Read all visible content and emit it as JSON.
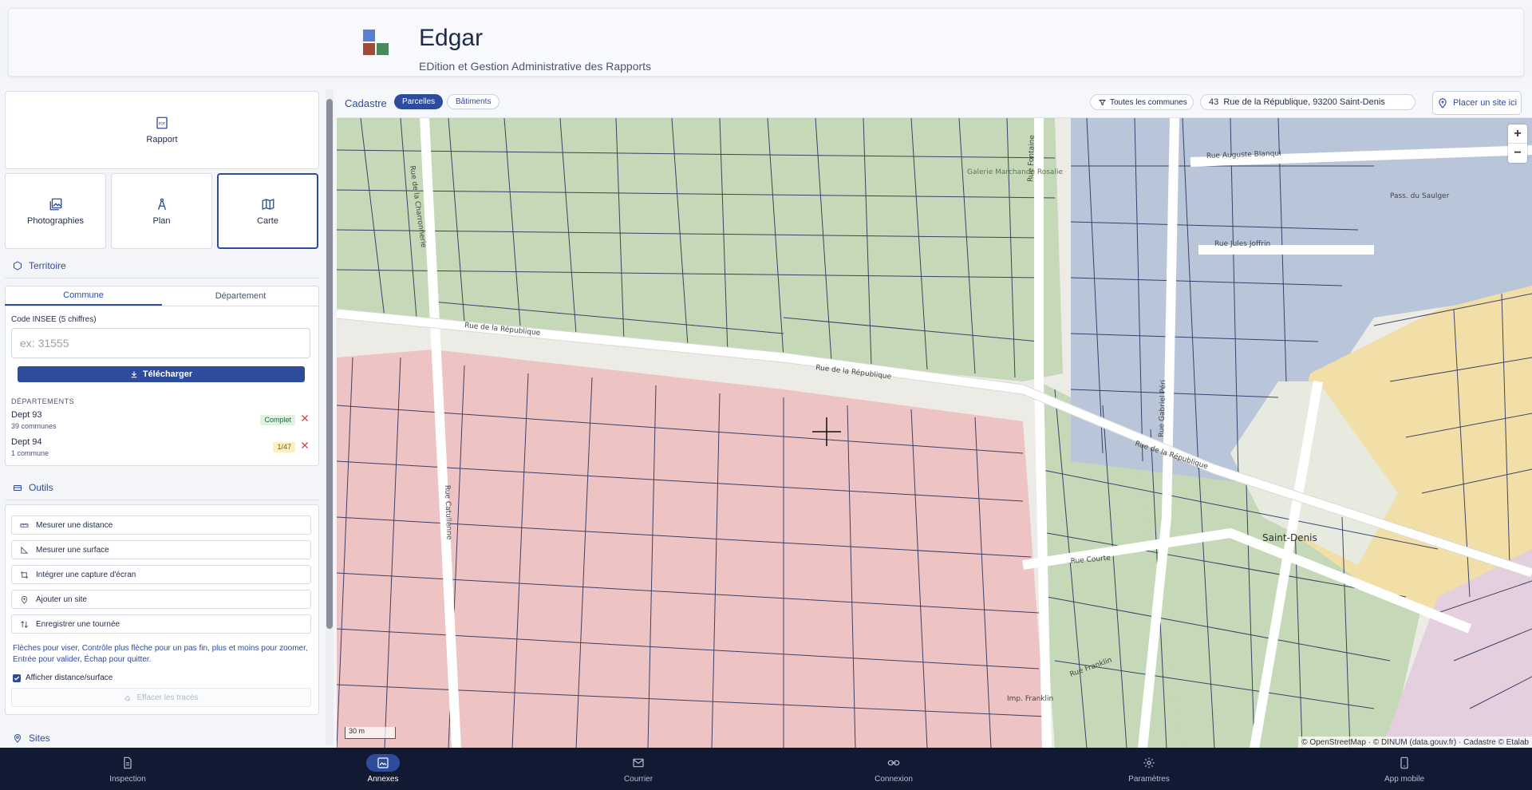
{
  "header": {
    "title": "Edgar",
    "subtitle": "EDition et Gestion Administrative des Rapports",
    "logo_colors": [
      "#5b7fd6",
      "#a04a3a",
      "#4a8a5a",
      "#ffffff"
    ]
  },
  "sidebar": {
    "tiles": [
      {
        "label": "Rapport",
        "icon": "pdf-icon"
      },
      {
        "label": "Photographies",
        "icon": "gallery-icon"
      },
      {
        "label": "Plan",
        "icon": "compass-icon"
      },
      {
        "label": "Carte",
        "icon": "map-icon"
      }
    ],
    "territoire": {
      "heading": "Territoire",
      "tabs": [
        "Commune",
        "Département"
      ],
      "field_label": "Code INSEE (5 chiffres)",
      "placeholder": "ex: 31555",
      "download_label": "Télécharger",
      "departements_heading": "Départements",
      "departements": [
        {
          "name": "Dept 93",
          "count": "39 communes",
          "badge": "Complet"
        },
        {
          "name": "Dept 94",
          "count": "1 commune",
          "badge": "1/47"
        }
      ]
    },
    "outils": {
      "heading": "Outils",
      "tools": [
        {
          "label": "Mesurer une distance",
          "icon": "ruler-icon"
        },
        {
          "label": "Mesurer une surface",
          "icon": "area-icon"
        },
        {
          "label": "Intégrer une capture d'écran",
          "icon": "crop-icon"
        },
        {
          "label": "Ajouter un site",
          "icon": "add-location-icon"
        },
        {
          "label": "Enregistrer une tournée",
          "icon": "route-icon"
        }
      ],
      "hint": "Flèches pour viser, Contrôle plus flèche pour un pas fin, plus et moins pour zoomer, Entrée pour valider, Échap pour quitter.",
      "checkbox_label": "Afficher distance/surface",
      "clear_label": "Effacer les tracés"
    },
    "sites": {
      "heading": "Sites"
    }
  },
  "map": {
    "cadastre_label": "Cadastre",
    "pills": [
      "Parcelles",
      "Bâtiments"
    ],
    "filter_label": "Toutes les communes",
    "address": "43  Rue de la République, 93200 Saint-Denis",
    "place_label": "Placer un site ici",
    "zoom_in": "+",
    "zoom_out": "−",
    "scale": "30 m",
    "attribution": "© OpenStreetMap · © DINUM (data.gouv.fr) · Cadastre © Etalab",
    "streets": [
      {
        "label": "Rue de la République"
      },
      {
        "label": "Rue Gabriel Péri"
      },
      {
        "label": "Rue Catulienne"
      },
      {
        "label": "Rue de la Charronnerie"
      },
      {
        "label": "Rue Auguste Blanqui"
      },
      {
        "label": "Rue Jules Joffrin"
      },
      {
        "label": "Pass. du Saulger"
      },
      {
        "label": "Rue Fontaine"
      },
      {
        "label": "Rue Courte"
      },
      {
        "label": "Rue Franklin"
      },
      {
        "label": "Imp. Franklin"
      },
      {
        "label": "Saint-Denis"
      },
      {
        "label": "Galerie Marchande Rosalie"
      }
    ],
    "colors": {
      "red": "#eec3c3",
      "green": "#c5d8b7",
      "blue": "#b9c6d9",
      "yellow": "#f2dfa7",
      "purple": "#e3cfdd",
      "outline": "#1e2a5a"
    }
  },
  "nav": [
    {
      "label": "Inspection",
      "icon": "document-icon"
    },
    {
      "label": "Annexes",
      "icon": "image-icon",
      "active": true
    },
    {
      "label": "Courrier",
      "icon": "mail-icon"
    },
    {
      "label": "Connexion",
      "icon": "link-icon"
    },
    {
      "label": "Paramètres",
      "icon": "gear-icon"
    },
    {
      "label": "App mobile",
      "icon": "phone-icon"
    }
  ]
}
